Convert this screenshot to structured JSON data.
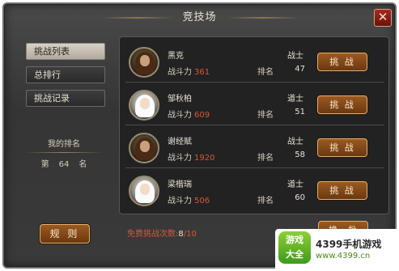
{
  "window": {
    "title": "竞技场"
  },
  "icons": {
    "close": "close-icon"
  },
  "nav": {
    "items": [
      {
        "label": "挑战列表",
        "active": true
      },
      {
        "label": "总排行",
        "active": false
      },
      {
        "label": "挑战记录",
        "active": false
      }
    ]
  },
  "my_rank": {
    "label": "我的排名",
    "prefix": "第",
    "value": "64",
    "suffix": "名"
  },
  "rule_button": "规 则",
  "opponents": [
    {
      "name": "黑克",
      "class": "战士",
      "power_label": "战斗力",
      "power": "361",
      "rank_label": "排名",
      "rank": "47",
      "button": "挑 战",
      "avatar": "warrior"
    },
    {
      "name": "邹秋柏",
      "class": "道士",
      "power_label": "战斗力",
      "power": "609",
      "rank_label": "排名",
      "rank": "51",
      "button": "挑 战",
      "avatar": "mage"
    },
    {
      "name": "谢经赋",
      "class": "战士",
      "power_label": "战斗力",
      "power": "1920",
      "rank_label": "排名",
      "rank": "58",
      "button": "挑 战",
      "avatar": "warrior"
    },
    {
      "name": "梁楷瑞",
      "class": "道士",
      "power_label": "战斗力",
      "power": "506",
      "rank_label": "排名",
      "rank": "60",
      "button": "挑 战",
      "avatar": "mage"
    }
  ],
  "free_challenges": {
    "label": "免费挑战次数:",
    "current": "8",
    "total": "/10"
  },
  "refresh_button": "换一批",
  "watermark": {
    "logo_top": "游戏",
    "logo_bottom": "大全",
    "line1": "4399手机游戏",
    "line2": "www.4399.cn"
  },
  "colors": {
    "accent_red": "#d8563a",
    "button_brown": "#9a5a22",
    "panel_bg": "#3a3a3a"
  }
}
